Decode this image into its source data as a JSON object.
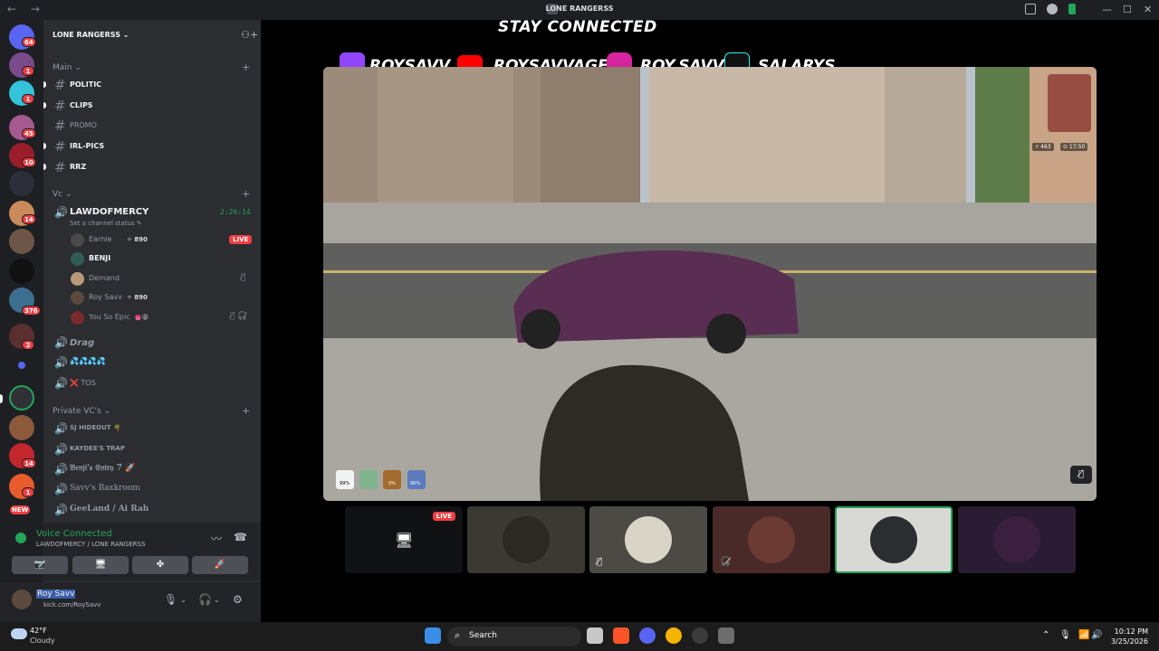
{
  "window": {
    "nav_arrows": "← →",
    "title": "LONE RANGERSS",
    "controls": [
      "—",
      "☐",
      "✕"
    ]
  },
  "guild_list": {
    "badges": [
      "64",
      "1",
      "1",
      "45",
      "10",
      "14",
      "376",
      "2",
      "14",
      "1"
    ],
    "new_label": "NEW"
  },
  "server": {
    "name": "LONE RANGERSS",
    "chevron": "⌄",
    "add_friend_icon": "add-member-icon"
  },
  "categories": {
    "main": "Main ⌄",
    "vc": "Vc ⌄",
    "private": "Private VC's ⌄",
    "add": "+"
  },
  "text_channels": [
    {
      "name": "POLITIC",
      "hash": "#"
    },
    {
      "name": "CLIPS",
      "hash": "#"
    },
    {
      "name": "PROMO",
      "hash": "#"
    },
    {
      "name": "IRL-PICS",
      "hash": "#"
    },
    {
      "name": "RRZ",
      "hash": "#"
    }
  ],
  "voice": {
    "active_channel": "LAWDOFMERCY",
    "status_hint": "Set a channel status ✎",
    "timer": "2:26:14",
    "speaker": "🔊",
    "members": [
      {
        "name": "Earnie",
        "tag": "✧ 890",
        "live": "LIVE"
      },
      {
        "name": "BENJI"
      },
      {
        "name": "Demand",
        "mute": "🎙̸"
      },
      {
        "name": "Roy Savv",
        "tag": "✧ 890"
      },
      {
        "name": "You So Epic",
        "tag": "👅😝",
        "mute": "🎙̸ 🎧̸"
      }
    ],
    "other_channels": [
      "Drag",
      "💦💦💦💦",
      "❌ TOS"
    ],
    "private_channels": [
      "SJ HIDEOUT 🌴",
      "KAYDEE'S TRAP",
      "𝔅𝔢𝔫𝔧𝔦'𝔰 𝔈𝔫𝔱𝔯𝔶 7 🚀",
      "Savv's Baxkroom",
      "GeeLand / Ai Rah"
    ]
  },
  "voice_panel": {
    "connected": "Voice Connected",
    "channel": "LAWDOFMERCY / LONE RANGERSS",
    "icons": [
      "〰",
      "☎"
    ],
    "buttons": [
      "📷̸",
      "🖥",
      "✤",
      "🚀"
    ]
  },
  "user": {
    "name": "Roy Savv",
    "sub": "kick.com/RoySavv",
    "mic": "🎙",
    "headset": "🎧",
    "settings": "⚙",
    "chev": "⌄"
  },
  "stream": {
    "headline": "STAY CONNECTED",
    "socials": [
      {
        "icon": "twitch-icon",
        "label": "ROYSAVV",
        "color": "#9146ff"
      },
      {
        "icon": "youtube-icon",
        "label": "ROYSAVVAGE",
        "color": "#ff0000"
      },
      {
        "icon": "instagram-icon",
        "label": "ROY.SAVV",
        "color": "#d6249f"
      },
      {
        "icon": "tiktok-icon",
        "label": "SALARYS",
        "color": "#111111"
      }
    ],
    "hud_top": [
      "⚡ 463",
      "⊙ 17:50"
    ],
    "hud_stats": [
      "99%",
      "",
      "0%",
      "96%"
    ],
    "muted_mic": "🎙̸"
  },
  "participants": {
    "live_label": "LIVE",
    "screen_icon": "🖥",
    "tiles": [
      {
        "name": "screen-share-tile"
      },
      {
        "name": "participant-tile-2"
      },
      {
        "name": "participant-tile-3",
        "mute": "🎙̸"
      },
      {
        "name": "participant-tile-4",
        "mute": "🎧̸"
      },
      {
        "name": "participant-tile-5"
      },
      {
        "name": "participant-tile-6"
      }
    ]
  },
  "taskbar": {
    "temp": "42°F",
    "condition": "Cloudy",
    "search": "Search",
    "time": "10:12 PM",
    "date": "3/25/2026",
    "tray": [
      "⌃",
      "🎙",
      "📶",
      "🔊",
      "🔋"
    ]
  },
  "colors": {
    "accent_green": "#23a55a",
    "live_red": "#f23f43",
    "sidebar": "#2b2d31",
    "rail": "#1e1f22"
  }
}
